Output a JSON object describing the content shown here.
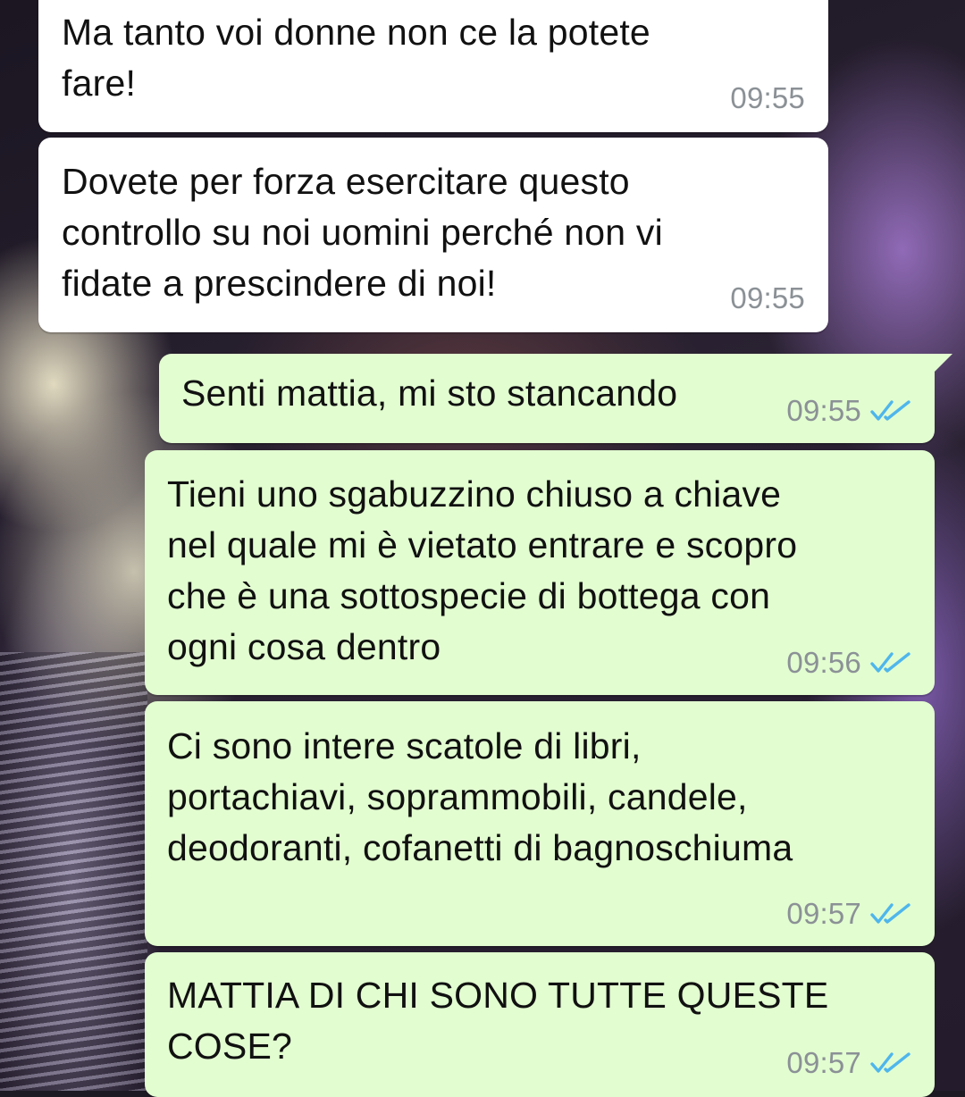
{
  "chat": {
    "messages": [
      {
        "direction": "incoming",
        "lines": [
          "Ma tanto voi donne non ce la potete",
          "fare!"
        ],
        "time": "09:55"
      },
      {
        "direction": "incoming",
        "lines": [
          "Dovete per forza esercitare questo",
          "controllo su noi uomini perché non vi",
          "fidate a prescindere di noi!"
        ],
        "time": "09:55"
      },
      {
        "direction": "outgoing",
        "lines": [
          "Senti mattia, mi sto stancando"
        ],
        "time": "09:55",
        "status": "read-double-check-icon"
      },
      {
        "direction": "outgoing",
        "lines": [
          "Tieni uno sgabuzzino chiuso a chiave",
          "nel quale mi è vietato entrare e scopro",
          "che è una sottospecie di bottega con",
          "ogni cosa dentro"
        ],
        "time": "09:56",
        "status": "read-double-check-icon"
      },
      {
        "direction": "outgoing",
        "lines": [
          "Ci sono intere scatole di libri,",
          "portachiavi, soprammobili, candele,",
          "deodoranti, cofanetti di bagnoschiuma"
        ],
        "time": "09:57",
        "status": "read-double-check-icon"
      },
      {
        "direction": "outgoing",
        "lines": [
          "MATTIA DI CHI SONO TUTTE QUESTE",
          "COSE?"
        ],
        "time": "09:57",
        "status": "read-double-check-icon"
      }
    ]
  },
  "colors": {
    "incoming_bubble": "#ffffff",
    "outgoing_bubble": "#e2fdd0",
    "timestamp": "#8b9196",
    "read_ticks": "#4fb6ec"
  }
}
